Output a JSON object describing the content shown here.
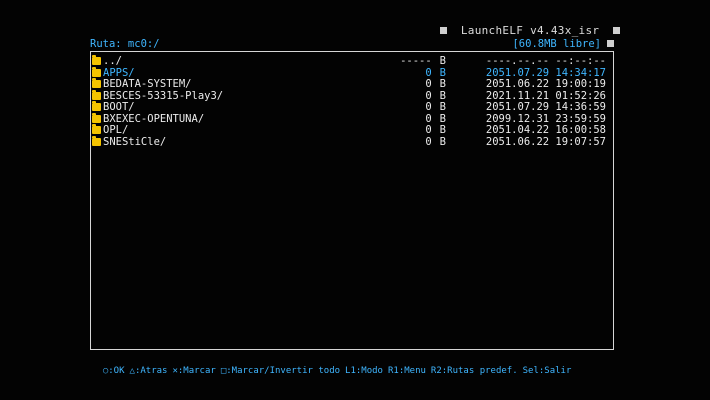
{
  "header": {
    "title": "LaunchELF v4.43x_isr",
    "path_label": "Ruta: mc0:/",
    "free_space": "[60.8MB libre]"
  },
  "colors": {
    "background": "#030303",
    "accent": "#3fb6ff",
    "text": "#ececec",
    "folder": "#f5c400",
    "frame": "#d6d6d6"
  },
  "files": [
    {
      "name": "../",
      "size": "-----",
      "unit": "B",
      "datetime": "----.--.-- --:--:--",
      "selected": false
    },
    {
      "name": "APPS/",
      "size": "0",
      "unit": "B",
      "datetime": "2051.07.29 14:34:17",
      "selected": true
    },
    {
      "name": "BEDATA-SYSTEM/",
      "size": "0",
      "unit": "B",
      "datetime": "2051.06.22 19:00:19",
      "selected": false
    },
    {
      "name": "BESCES-53315-Play3/",
      "size": "0",
      "unit": "B",
      "datetime": "2021.11.21 01:52:26",
      "selected": false
    },
    {
      "name": "BOOT/",
      "size": "0",
      "unit": "B",
      "datetime": "2051.07.29 14:36:59",
      "selected": false
    },
    {
      "name": "BXEXEC-OPENTUNA/",
      "size": "0",
      "unit": "B",
      "datetime": "2099.12.31 23:59:59",
      "selected": false
    },
    {
      "name": "OPL/",
      "size": "0",
      "unit": "B",
      "datetime": "2051.04.22 16:00:58",
      "selected": false
    },
    {
      "name": "SNEStiCle/",
      "size": "0",
      "unit": "B",
      "datetime": "2051.06.22 19:07:57",
      "selected": false
    }
  ],
  "footer": {
    "circle": "○:OK",
    "triangle": "△:Atras",
    "cross": "✕:Marcar",
    "square": "□:Marcar/Invertir todo",
    "l1": "L1:Modo",
    "r1": "R1:Menu",
    "r2": "R2:Rutas predef.",
    "sel": "Sel:Salir"
  }
}
